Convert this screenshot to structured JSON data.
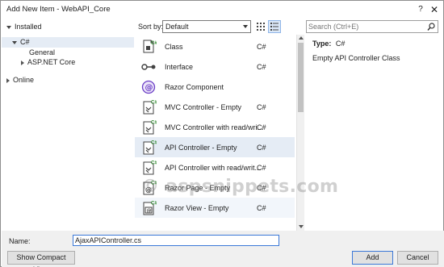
{
  "window": {
    "title": "Add New Item - WebAPI_Core",
    "help_glyph": "?",
    "close_glyph": "✕"
  },
  "tree": {
    "installed": "Installed",
    "csharp": "C#",
    "general": "General",
    "aspnet": "ASP.NET Core",
    "online": "Online"
  },
  "toolbar": {
    "sort_label": "Sort by:",
    "sort_value": "Default"
  },
  "items": [
    {
      "name": "Class",
      "lang": "C#",
      "icon": "class-icon"
    },
    {
      "name": "Interface",
      "lang": "C#",
      "icon": "interface-icon"
    },
    {
      "name": "Razor Component",
      "lang": "",
      "icon": "razor-component-icon"
    },
    {
      "name": "MVC Controller - Empty",
      "lang": "C#",
      "icon": "controller-icon"
    },
    {
      "name": "MVC Controller with read/wri...",
      "lang": "C#",
      "icon": "controller-icon"
    },
    {
      "name": "API Controller - Empty",
      "lang": "C#",
      "icon": "controller-icon"
    },
    {
      "name": "API Controller with read/writ...",
      "lang": "C#",
      "icon": "controller-icon"
    },
    {
      "name": "Razor Page - Empty",
      "lang": "C#",
      "icon": "razor-page-icon"
    },
    {
      "name": "Razor View - Empty",
      "lang": "C#",
      "icon": "razor-view-icon"
    }
  ],
  "search": {
    "placeholder": "Search (Ctrl+E)"
  },
  "details": {
    "type_label": "Type:",
    "type_value": "C#",
    "description": "Empty API Controller Class"
  },
  "form": {
    "name_label": "Name:",
    "name_value": "AjaxAPIController.cs"
  },
  "buttons": {
    "compact": "Show Compact View",
    "add": "Add",
    "cancel": "Cancel"
  },
  "watermark": "© aspsnippets.com",
  "colors": {
    "selection": "#e5ecf5",
    "accent": "#3b78d8",
    "csharp_green": "#2f8a2f"
  }
}
